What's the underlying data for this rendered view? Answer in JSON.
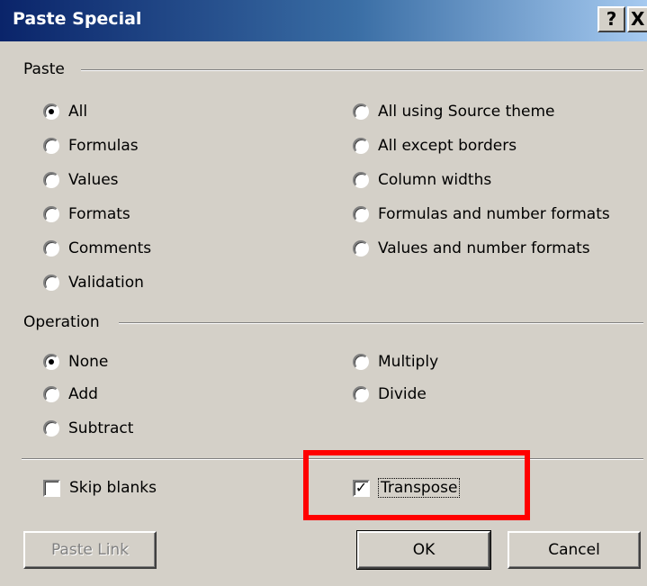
{
  "window": {
    "title": "Paste Special",
    "help_glyph": "?",
    "close_glyph": "X"
  },
  "paste": {
    "label": "Paste",
    "options": [
      {
        "label": "All",
        "checked": true
      },
      {
        "label": "Formulas",
        "checked": false
      },
      {
        "label": "Values",
        "checked": false
      },
      {
        "label": "Formats",
        "checked": false
      },
      {
        "label": "Comments",
        "checked": false
      },
      {
        "label": "Validation",
        "checked": false
      },
      {
        "label": "All using Source theme",
        "checked": false
      },
      {
        "label": "All except borders",
        "checked": false
      },
      {
        "label": "Column widths",
        "checked": false
      },
      {
        "label": "Formulas and number formats",
        "checked": false
      },
      {
        "label": "Values and number formats",
        "checked": false
      }
    ]
  },
  "operation": {
    "label": "Operation",
    "options": [
      {
        "label": "None",
        "checked": true
      },
      {
        "label": "Add",
        "checked": false
      },
      {
        "label": "Subtract",
        "checked": false
      },
      {
        "label": "Multiply",
        "checked": false
      },
      {
        "label": "Divide",
        "checked": false
      }
    ]
  },
  "checkboxes": {
    "skip_blanks": {
      "label": "Skip blanks",
      "checked": false
    },
    "transpose": {
      "label": "Transpose",
      "checked": true,
      "check_glyph": "✓"
    }
  },
  "buttons": {
    "paste_link": "Paste Link",
    "ok": "OK",
    "cancel": "Cancel"
  },
  "colors": {
    "dialog_bg": "#d4d0c8",
    "titlebar_start": "#0a246a",
    "highlight": "#ff0000"
  }
}
